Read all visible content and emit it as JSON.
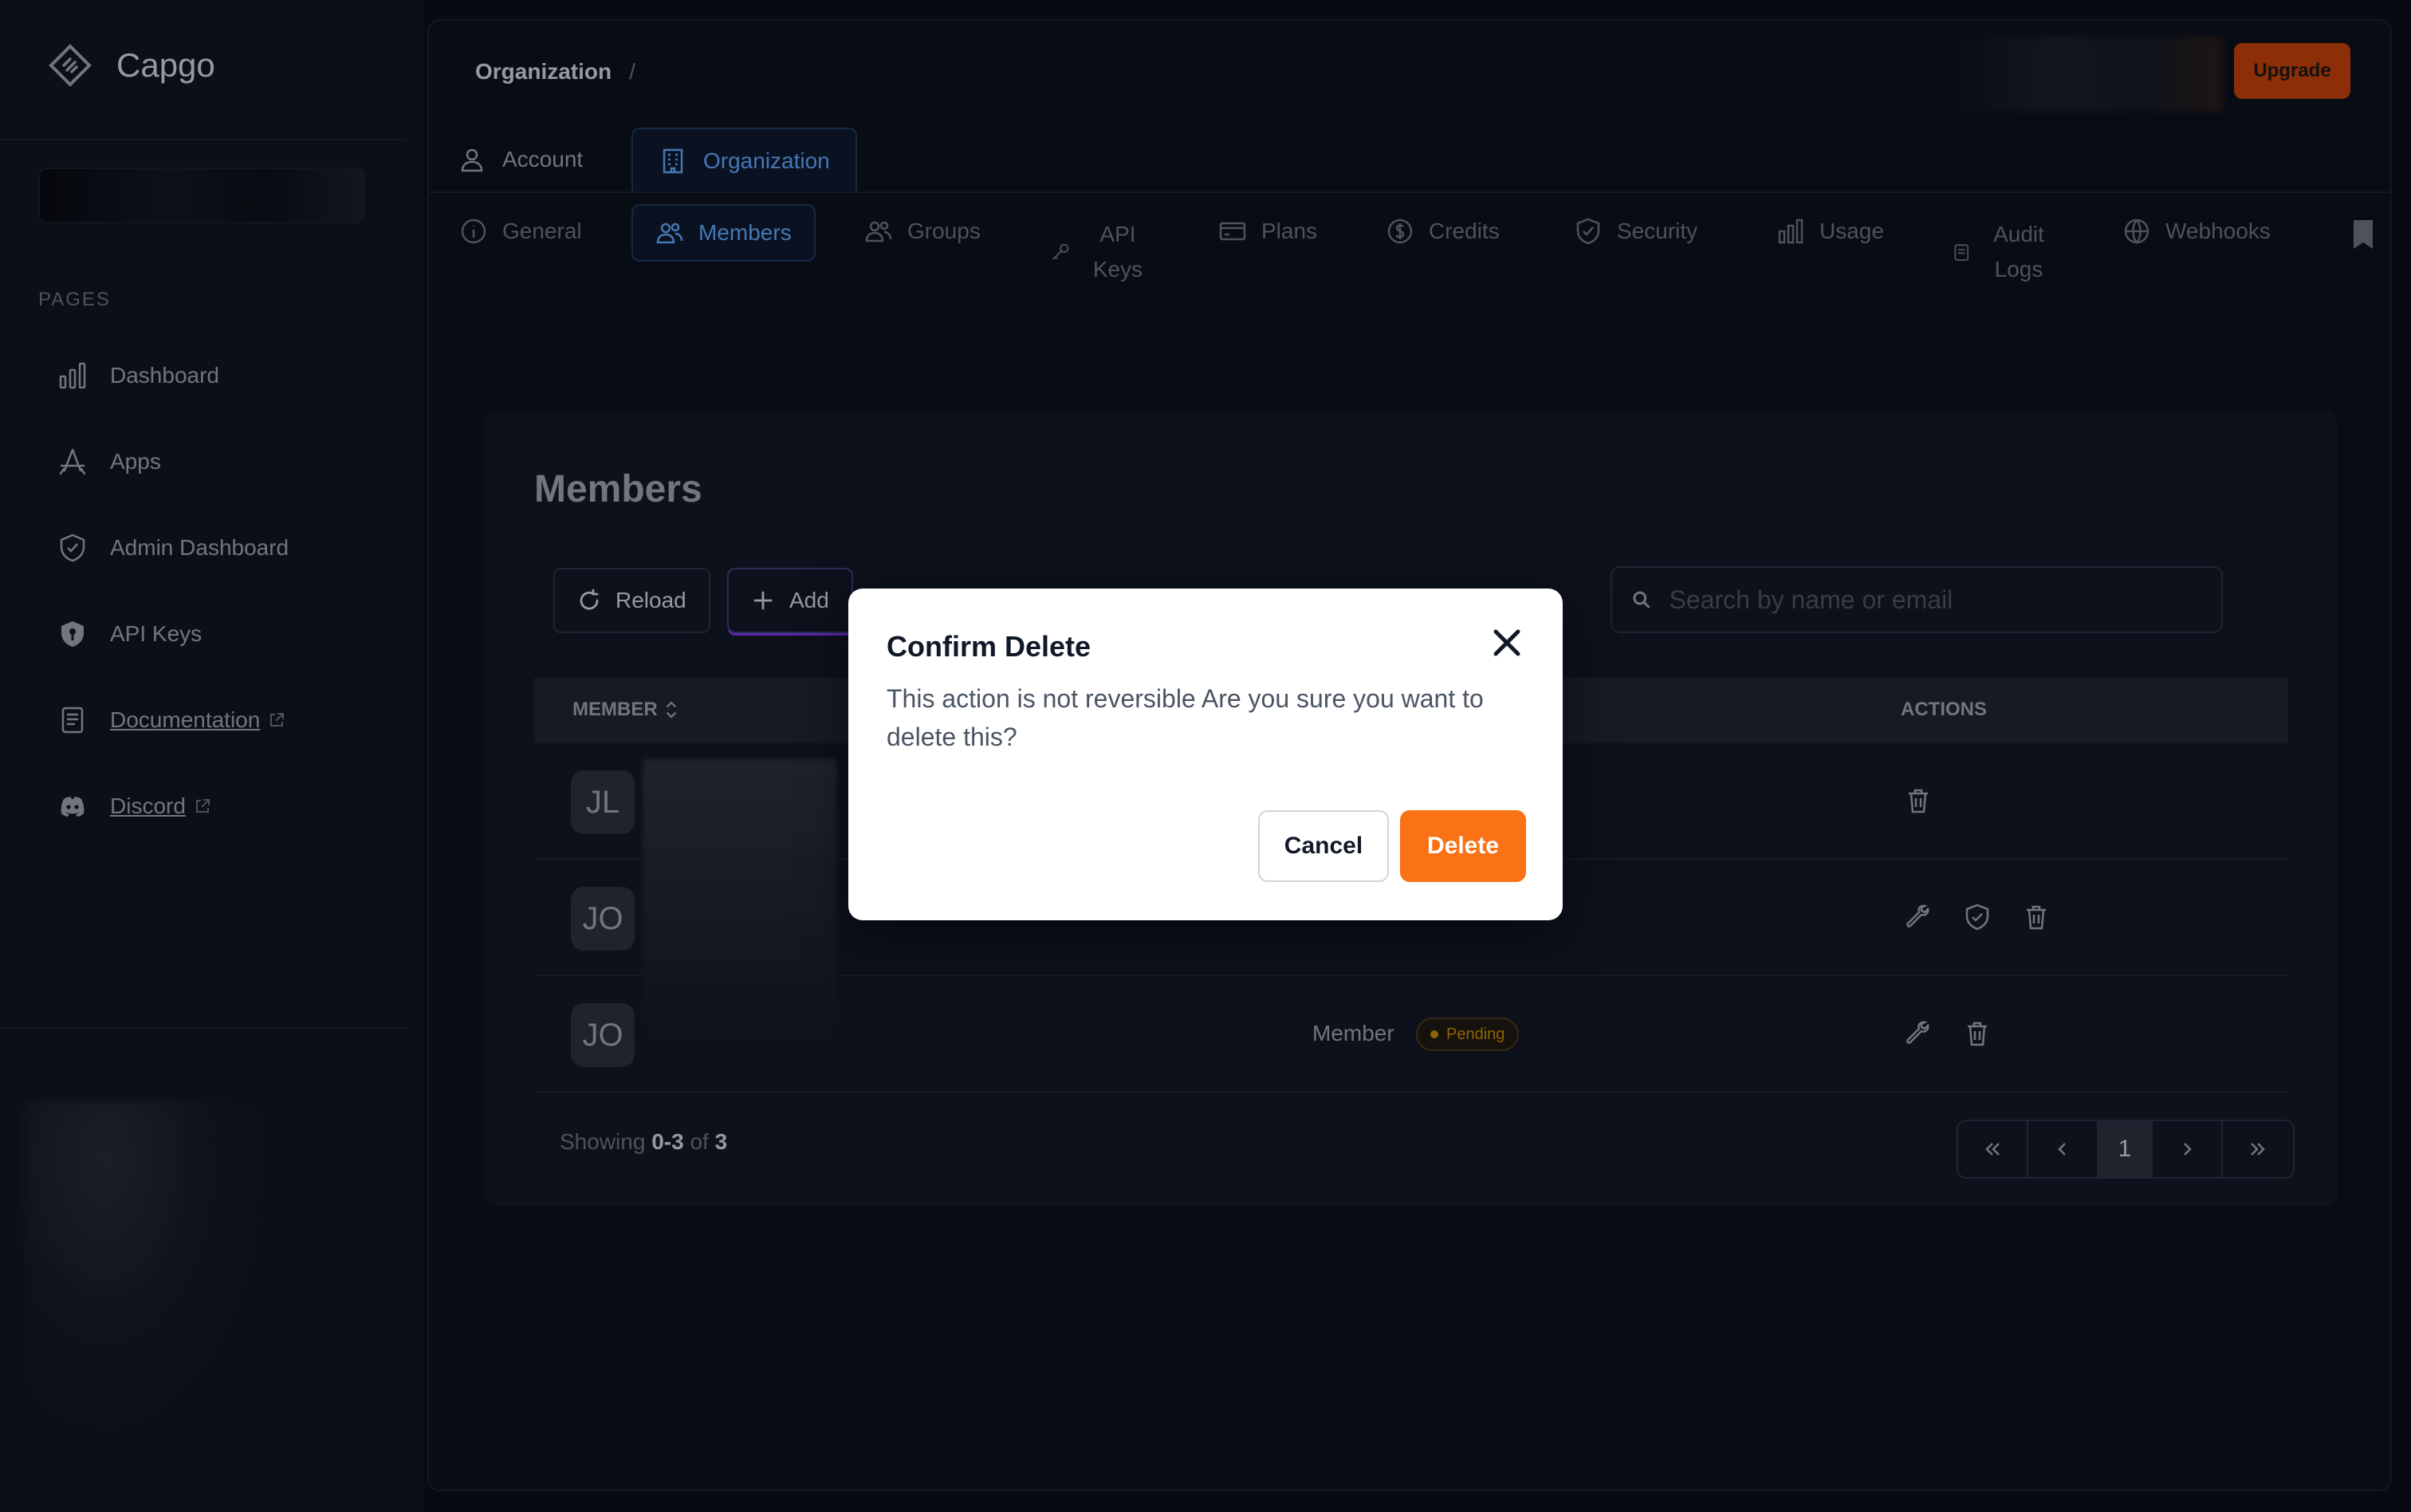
{
  "app": {
    "name": "Capgo"
  },
  "sidebar": {
    "section_label": "PAGES",
    "items": [
      {
        "label": "Dashboard",
        "icon": "chart-bar-icon"
      },
      {
        "label": "Apps",
        "icon": "app-store-icon"
      },
      {
        "label": "Admin Dashboard",
        "icon": "shield-check-icon"
      },
      {
        "label": "API Keys",
        "icon": "shield-key-icon"
      },
      {
        "label": "Documentation",
        "icon": "document-icon",
        "external": true
      },
      {
        "label": "Discord",
        "icon": "discord-icon",
        "external": true
      }
    ]
  },
  "header": {
    "breadcrumb": "Organization",
    "breadcrumb_separator": "/",
    "upgrade_label": "Upgrade"
  },
  "top_tabs": [
    {
      "label": "Account",
      "icon": "user-icon",
      "active": false
    },
    {
      "label": "Organization",
      "icon": "building-icon",
      "active": true
    }
  ],
  "sub_tabs": [
    {
      "label": "General",
      "icon": "info-icon"
    },
    {
      "label": "Members",
      "icon": "users-icon",
      "active": true
    },
    {
      "label": "Groups",
      "icon": "users-icon"
    },
    {
      "label": "API Keys",
      "icon": "key-icon"
    },
    {
      "label": "Plans",
      "icon": "credit-card-icon"
    },
    {
      "label": "Credits",
      "icon": "dollar-circle-icon"
    },
    {
      "label": "Security",
      "icon": "shield-check-icon"
    },
    {
      "label": "Usage",
      "icon": "chart-bar-icon"
    },
    {
      "label": "Audit Logs",
      "icon": "list-icon"
    },
    {
      "label": "Webhooks",
      "icon": "globe-icon"
    }
  ],
  "members": {
    "title": "Members",
    "reload_label": "Reload",
    "add_label": "Add",
    "search_placeholder": "Search by name or email",
    "columns": {
      "member": "MEMBER",
      "actions": "ACTIONS"
    },
    "rows": [
      {
        "initials": "JL",
        "role": "",
        "status": ""
      },
      {
        "initials": "JO",
        "role": "",
        "status": ""
      },
      {
        "initials": "JO",
        "role": "Member",
        "status": "Pending"
      }
    ],
    "showing_prefix": "Showing",
    "showing_range": "0-3",
    "showing_of": "of",
    "showing_total": "3",
    "current_page": "1"
  },
  "modal": {
    "title": "Confirm Delete",
    "message": "This action is not reversible Are you sure you want to delete this?",
    "cancel_label": "Cancel",
    "delete_label": "Delete"
  },
  "colors": {
    "accent_blue": "#60a5fa",
    "delete_orange": "#f97316",
    "upgrade_orange": "#c2410c",
    "pending_yellow": "#ca8a04"
  }
}
